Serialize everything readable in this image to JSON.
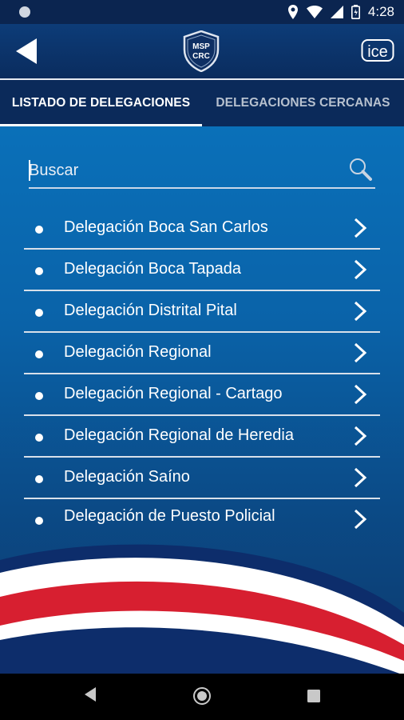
{
  "status_bar": {
    "time": "4:28",
    "icons": [
      "notification-dot-icon",
      "location-icon",
      "wifi-icon",
      "signal-icon",
      "battery-icon"
    ]
  },
  "app_bar": {
    "logo_text_line1": "MSP",
    "logo_text_line2": "CRC",
    "right_logo_text": "ice"
  },
  "tabs": [
    {
      "label": "LISTADO DE DELEGACIONES",
      "active": true
    },
    {
      "label": "DELEGACIONES CERCANAS",
      "active": false
    }
  ],
  "search": {
    "placeholder": "Buscar"
  },
  "delegations": [
    {
      "label": "Delegación Boca San Carlos"
    },
    {
      "label": "Delegación Boca Tapada"
    },
    {
      "label": "Delegación Distrital Pital"
    },
    {
      "label": "Delegación Regional"
    },
    {
      "label": "Delegación Regional - Cartago"
    },
    {
      "label": "Delegación Regional de Heredia"
    },
    {
      "label": "Delegación Saíno"
    },
    {
      "label": "Delegación de  Puesto Policial"
    }
  ],
  "colors": {
    "flag_red": "#d71f30",
    "flag_blue": "#0d2d6b",
    "flag_white": "#ffffff"
  }
}
